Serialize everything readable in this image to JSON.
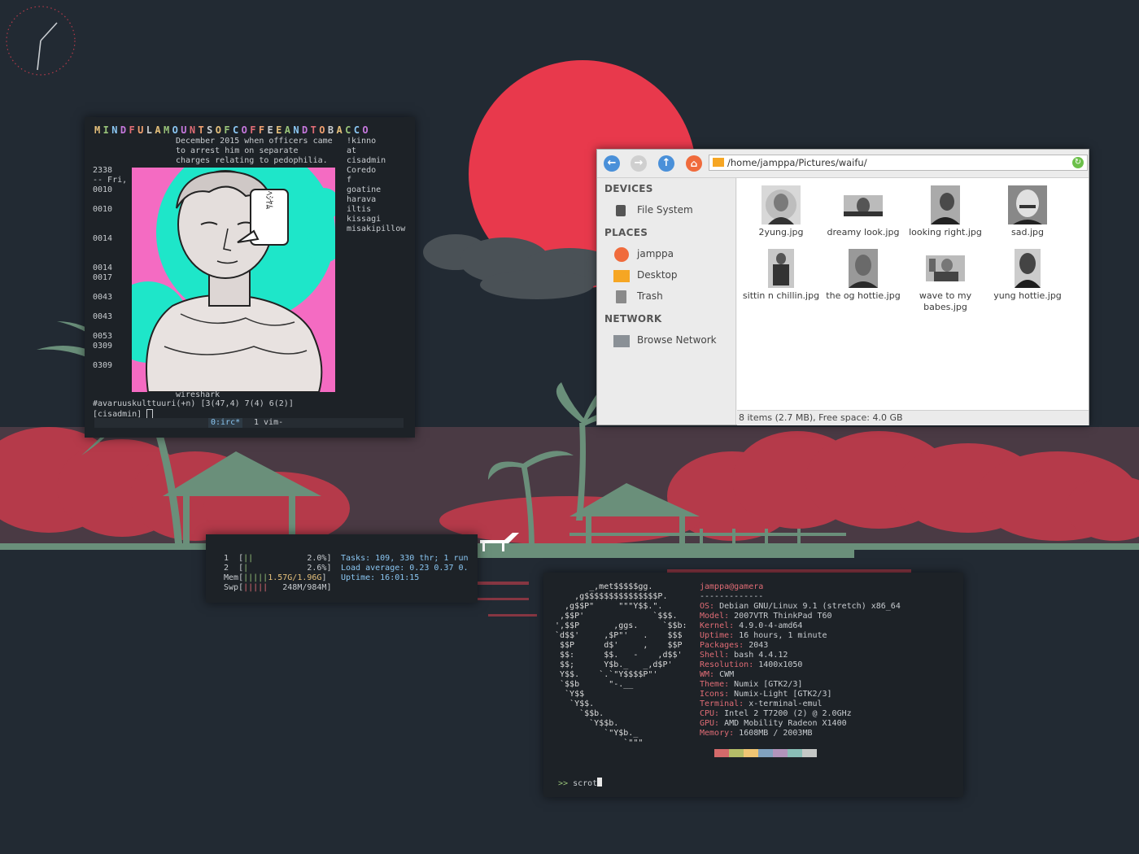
{
  "colors": {
    "bg": "#222a33",
    "sun": "#e8394c",
    "palm": "#6a8f7a",
    "clouds": "#b53a4a",
    "accent": "#4a90d9"
  },
  "irc": {
    "title": "MINDFULAMOUNTSOFCOFFEEANDTOBACCO",
    "message_lines": [
      "December 2015 when officers came",
      "to arrest him on separate",
      "charges relating to pedophilia."
    ],
    "timestamps": [
      "2338",
      "-- Fri,",
      "0010",
      "0010",
      "0014",
      "0014",
      "0017",
      "0043",
      "0043",
      "0053",
      "0309",
      "0309"
    ],
    "nicks": [
      "!kinno",
      "at",
      "cisadmin",
      "Coredo",
      "f",
      "goatine",
      "harava",
      "iltis",
      "kissagi",
      "misakipillow"
    ],
    "speech_bubble": "ﾍｼﾔﾑ",
    "bottom_nick": "wireshark",
    "channel_line": "#avaruuskulttuuri(+n) [3(47,4) 7(4) 6(2)]",
    "prompt": "[cisadmin]",
    "status_window_active": "0:irc*",
    "status_window_other": "1 vim-"
  },
  "htop": {
    "cpu1_label": "1",
    "cpu1_pct": "2.0%",
    "cpu2_label": "2",
    "cpu2_pct": "2.6%",
    "mem_label": "Mem",
    "mem_value": "1.57G/1.96G",
    "swp_label": "Swp",
    "swp_value": "248M/984M",
    "tasks": "Tasks: 109, 330 thr; 1 run",
    "load": "Load average: 0.23 0.37 0.",
    "uptime": "Uptime: 16:01:15"
  },
  "filemanager": {
    "path": "/home/jamppa/Pictures/waifu/",
    "sections": {
      "devices": "DEVICES",
      "places": "PLACES",
      "network": "NETWORK"
    },
    "devices": [
      "File System"
    ],
    "places": [
      "jamppa",
      "Desktop",
      "Trash"
    ],
    "network": [
      "Browse Network"
    ],
    "files": [
      {
        "name": "2yung.jpg"
      },
      {
        "name": "dreamy look.jpg"
      },
      {
        "name": "looking right.jpg"
      },
      {
        "name": "sad.jpg"
      },
      {
        "name": "sittin n chillin.jpg"
      },
      {
        "name": "the og hottie.jpg"
      },
      {
        "name": "wave to my babes.jpg"
      },
      {
        "name": "yung hottie.jpg"
      }
    ],
    "status": "8 items (2.7 MB), Free space: 4.0 GB",
    "icons": {
      "back": "arrow-left-icon",
      "forward": "arrow-right-icon",
      "up": "arrow-up-icon",
      "home": "home-icon",
      "refresh": "refresh-icon",
      "folder": "folder-icon"
    }
  },
  "neofetch": {
    "logo": [
      "       _,met$$$$$gg.",
      "    ,g$$$$$$$$$$$$$$$P.",
      "  ,g$$P\"     \"\"\"Y$$.\".",
      " ,$$P'              `$$$.",
      "',$$P       ,ggs.     `$$b:",
      "`d$$'     ,$P\"'   .    $$$",
      " $$P      d$'     ,    $$P",
      " $$:      $$.   -    ,d$$'",
      " $$;      Y$b._   _,d$P'",
      " Y$$.    `.`\"Y$$$$P\"'",
      " `$$b      \"-.__",
      "  `Y$$",
      "   `Y$$.",
      "     `$$b.",
      "       `Y$$b.",
      "          `\"Y$b._",
      "              `\"\"\""
    ],
    "userhost": "jamppa@gamera",
    "separator": "-------------",
    "info": [
      {
        "k": "OS",
        "v": "Debian GNU/Linux 9.1 (stretch) x86_64"
      },
      {
        "k": "Model",
        "v": "2007VTR ThinkPad T60"
      },
      {
        "k": "Kernel",
        "v": "4.9.0-4-amd64"
      },
      {
        "k": "Uptime",
        "v": "16 hours, 1 minute"
      },
      {
        "k": "Packages",
        "v": "2043"
      },
      {
        "k": "Shell",
        "v": "bash 4.4.12"
      },
      {
        "k": "Resolution",
        "v": "1400x1050"
      },
      {
        "k": "WM",
        "v": "CWM"
      },
      {
        "k": "Theme",
        "v": "Numix [GTK2/3]"
      },
      {
        "k": "Icons",
        "v": "Numix-Light [GTK2/3]"
      },
      {
        "k": "Terminal",
        "v": "x-terminal-emul"
      },
      {
        "k": "CPU",
        "v": "Intel 2 T7200 (2) @ 2.0GHz"
      },
      {
        "k": "GPU",
        "v": "AMD Mobility Radeon X1400"
      },
      {
        "k": "Memory",
        "v": "1608MB / 2003MB"
      }
    ],
    "palette": [
      "#d46a6a",
      "#b5bd68",
      "#f0c674",
      "#81a2be",
      "#b294bb",
      "#8abeb7",
      "#c5c8c6"
    ],
    "prompt": ">>",
    "command": "scrot"
  }
}
